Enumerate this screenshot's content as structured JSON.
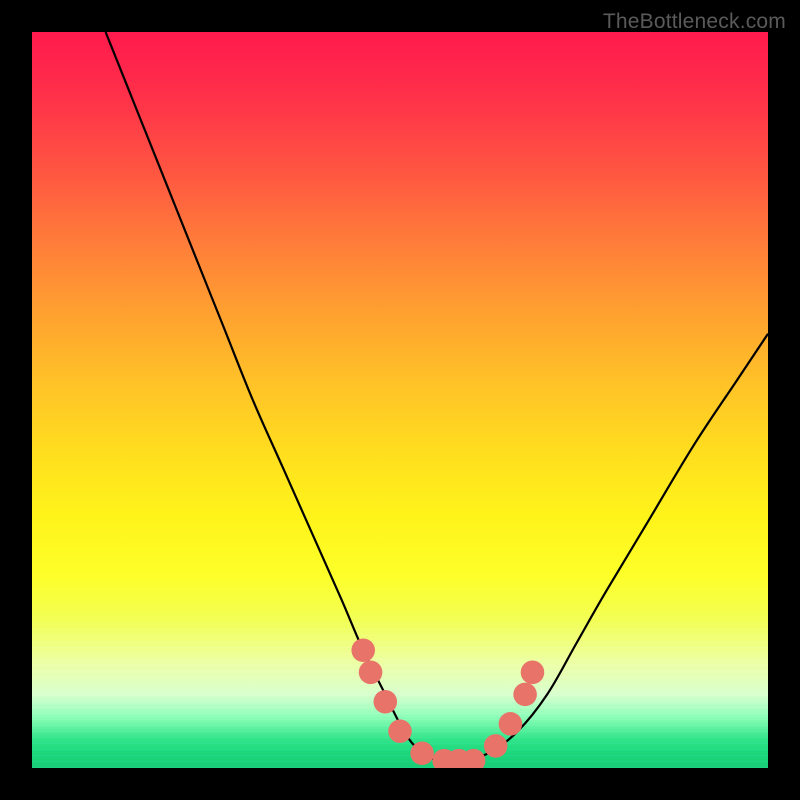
{
  "watermark": "TheBottleneck.com",
  "colors": {
    "marker": "#e77369",
    "curve": "#000000"
  },
  "chart_data": {
    "type": "line",
    "title": "",
    "xlabel": "",
    "ylabel": "",
    "xlim": [
      0,
      100
    ],
    "ylim": [
      0,
      100
    ],
    "grid": false,
    "legend": false,
    "series": [
      {
        "name": "curve",
        "x": [
          10,
          14,
          18,
          22,
          26,
          30,
          34,
          38,
          42,
          45,
          48,
          50,
          52,
          55,
          58,
          62,
          66,
          70,
          74,
          78,
          84,
          90,
          96,
          100
        ],
        "y": [
          100,
          90,
          80,
          70,
          60,
          50,
          41,
          32,
          23,
          16,
          10,
          6,
          3,
          1,
          1,
          2,
          5,
          10,
          17,
          24,
          34,
          44,
          53,
          59
        ]
      }
    ],
    "markers": [
      {
        "x": 45,
        "y": 16,
        "r": 1.6
      },
      {
        "x": 46,
        "y": 13,
        "r": 1.6
      },
      {
        "x": 48,
        "y": 9,
        "r": 1.6
      },
      {
        "x": 50,
        "y": 5,
        "r": 1.6
      },
      {
        "x": 53,
        "y": 2,
        "r": 1.6
      },
      {
        "x": 56,
        "y": 1,
        "r": 1.6
      },
      {
        "x": 58,
        "y": 1,
        "r": 1.6
      },
      {
        "x": 60,
        "y": 1,
        "r": 1.6
      },
      {
        "x": 63,
        "y": 3,
        "r": 1.6
      },
      {
        "x": 65,
        "y": 6,
        "r": 1.6
      },
      {
        "x": 67,
        "y": 10,
        "r": 1.6
      },
      {
        "x": 68,
        "y": 13,
        "r": 1.6
      }
    ],
    "pill_markers": [
      {
        "x1": 44.5,
        "y1": 17,
        "x2": 46.5,
        "y2": 12
      },
      {
        "x1": 47.5,
        "y1": 10,
        "x2": 49.5,
        "y2": 6
      },
      {
        "x1": 52,
        "y1": 2.5,
        "x2": 55,
        "y2": 1.2
      },
      {
        "x1": 55.5,
        "y1": 1,
        "x2": 61,
        "y2": 1
      },
      {
        "x1": 62.5,
        "y1": 2.5,
        "x2": 64.5,
        "y2": 5
      },
      {
        "x1": 66,
        "y1": 8,
        "x2": 67.5,
        "y2": 11
      },
      {
        "x1": 67.5,
        "y1": 12,
        "x2": 68.5,
        "y2": 15
      }
    ]
  }
}
